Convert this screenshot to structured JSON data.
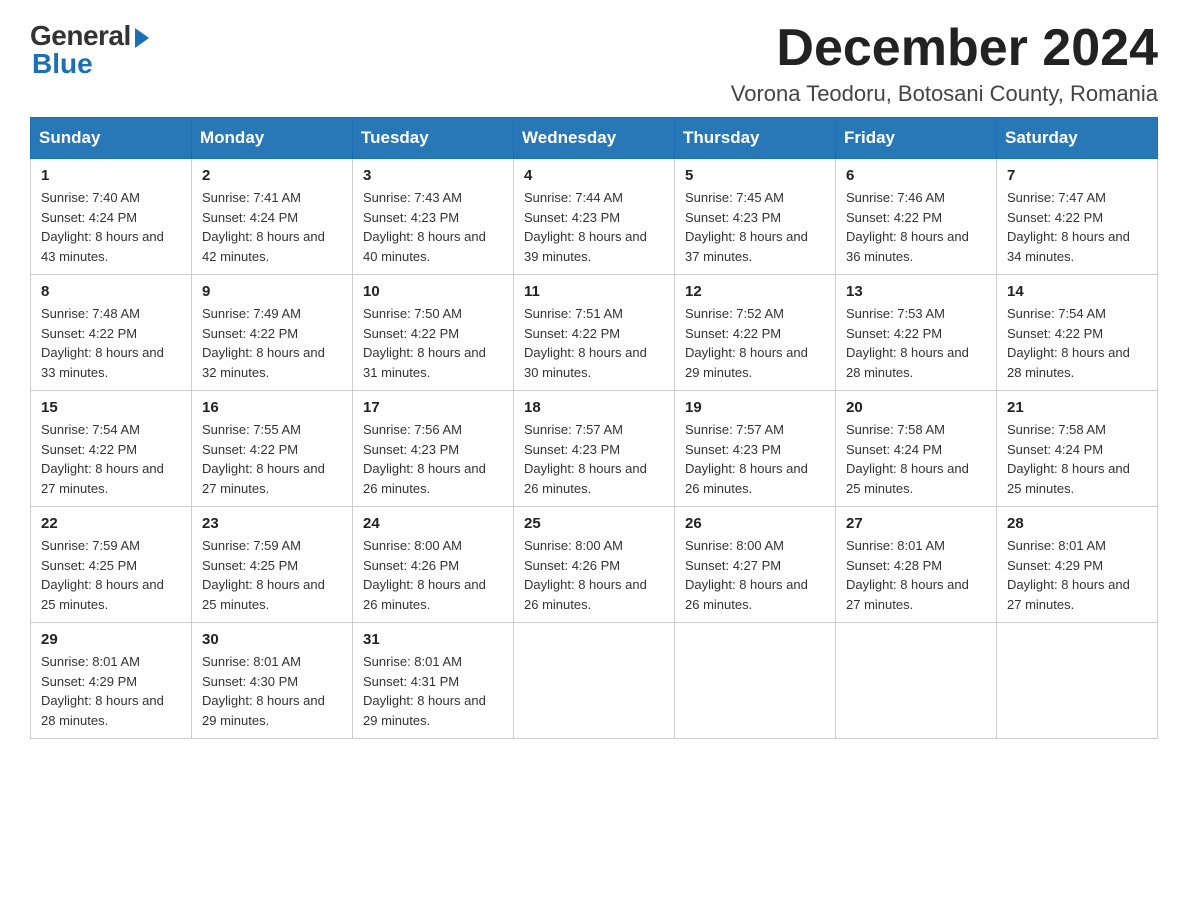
{
  "logo": {
    "general": "General",
    "blue": "Blue"
  },
  "header": {
    "month_title": "December 2024",
    "subtitle": "Vorona Teodoru, Botosani County, Romania"
  },
  "days_of_week": [
    "Sunday",
    "Monday",
    "Tuesday",
    "Wednesday",
    "Thursday",
    "Friday",
    "Saturday"
  ],
  "weeks": [
    [
      {
        "day": "1",
        "sunrise": "7:40 AM",
        "sunset": "4:24 PM",
        "daylight": "8 hours and 43 minutes."
      },
      {
        "day": "2",
        "sunrise": "7:41 AM",
        "sunset": "4:24 PM",
        "daylight": "8 hours and 42 minutes."
      },
      {
        "day": "3",
        "sunrise": "7:43 AM",
        "sunset": "4:23 PM",
        "daylight": "8 hours and 40 minutes."
      },
      {
        "day": "4",
        "sunrise": "7:44 AM",
        "sunset": "4:23 PM",
        "daylight": "8 hours and 39 minutes."
      },
      {
        "day": "5",
        "sunrise": "7:45 AM",
        "sunset": "4:23 PM",
        "daylight": "8 hours and 37 minutes."
      },
      {
        "day": "6",
        "sunrise": "7:46 AM",
        "sunset": "4:22 PM",
        "daylight": "8 hours and 36 minutes."
      },
      {
        "day": "7",
        "sunrise": "7:47 AM",
        "sunset": "4:22 PM",
        "daylight": "8 hours and 34 minutes."
      }
    ],
    [
      {
        "day": "8",
        "sunrise": "7:48 AM",
        "sunset": "4:22 PM",
        "daylight": "8 hours and 33 minutes."
      },
      {
        "day": "9",
        "sunrise": "7:49 AM",
        "sunset": "4:22 PM",
        "daylight": "8 hours and 32 minutes."
      },
      {
        "day": "10",
        "sunrise": "7:50 AM",
        "sunset": "4:22 PM",
        "daylight": "8 hours and 31 minutes."
      },
      {
        "day": "11",
        "sunrise": "7:51 AM",
        "sunset": "4:22 PM",
        "daylight": "8 hours and 30 minutes."
      },
      {
        "day": "12",
        "sunrise": "7:52 AM",
        "sunset": "4:22 PM",
        "daylight": "8 hours and 29 minutes."
      },
      {
        "day": "13",
        "sunrise": "7:53 AM",
        "sunset": "4:22 PM",
        "daylight": "8 hours and 28 minutes."
      },
      {
        "day": "14",
        "sunrise": "7:54 AM",
        "sunset": "4:22 PM",
        "daylight": "8 hours and 28 minutes."
      }
    ],
    [
      {
        "day": "15",
        "sunrise": "7:54 AM",
        "sunset": "4:22 PM",
        "daylight": "8 hours and 27 minutes."
      },
      {
        "day": "16",
        "sunrise": "7:55 AM",
        "sunset": "4:22 PM",
        "daylight": "8 hours and 27 minutes."
      },
      {
        "day": "17",
        "sunrise": "7:56 AM",
        "sunset": "4:23 PM",
        "daylight": "8 hours and 26 minutes."
      },
      {
        "day": "18",
        "sunrise": "7:57 AM",
        "sunset": "4:23 PM",
        "daylight": "8 hours and 26 minutes."
      },
      {
        "day": "19",
        "sunrise": "7:57 AM",
        "sunset": "4:23 PM",
        "daylight": "8 hours and 26 minutes."
      },
      {
        "day": "20",
        "sunrise": "7:58 AM",
        "sunset": "4:24 PM",
        "daylight": "8 hours and 25 minutes."
      },
      {
        "day": "21",
        "sunrise": "7:58 AM",
        "sunset": "4:24 PM",
        "daylight": "8 hours and 25 minutes."
      }
    ],
    [
      {
        "day": "22",
        "sunrise": "7:59 AM",
        "sunset": "4:25 PM",
        "daylight": "8 hours and 25 minutes."
      },
      {
        "day": "23",
        "sunrise": "7:59 AM",
        "sunset": "4:25 PM",
        "daylight": "8 hours and 25 minutes."
      },
      {
        "day": "24",
        "sunrise": "8:00 AM",
        "sunset": "4:26 PM",
        "daylight": "8 hours and 26 minutes."
      },
      {
        "day": "25",
        "sunrise": "8:00 AM",
        "sunset": "4:26 PM",
        "daylight": "8 hours and 26 minutes."
      },
      {
        "day": "26",
        "sunrise": "8:00 AM",
        "sunset": "4:27 PM",
        "daylight": "8 hours and 26 minutes."
      },
      {
        "day": "27",
        "sunrise": "8:01 AM",
        "sunset": "4:28 PM",
        "daylight": "8 hours and 27 minutes."
      },
      {
        "day": "28",
        "sunrise": "8:01 AM",
        "sunset": "4:29 PM",
        "daylight": "8 hours and 27 minutes."
      }
    ],
    [
      {
        "day": "29",
        "sunrise": "8:01 AM",
        "sunset": "4:29 PM",
        "daylight": "8 hours and 28 minutes."
      },
      {
        "day": "30",
        "sunrise": "8:01 AM",
        "sunset": "4:30 PM",
        "daylight": "8 hours and 29 minutes."
      },
      {
        "day": "31",
        "sunrise": "8:01 AM",
        "sunset": "4:31 PM",
        "daylight": "8 hours and 29 minutes."
      },
      null,
      null,
      null,
      null
    ]
  ]
}
